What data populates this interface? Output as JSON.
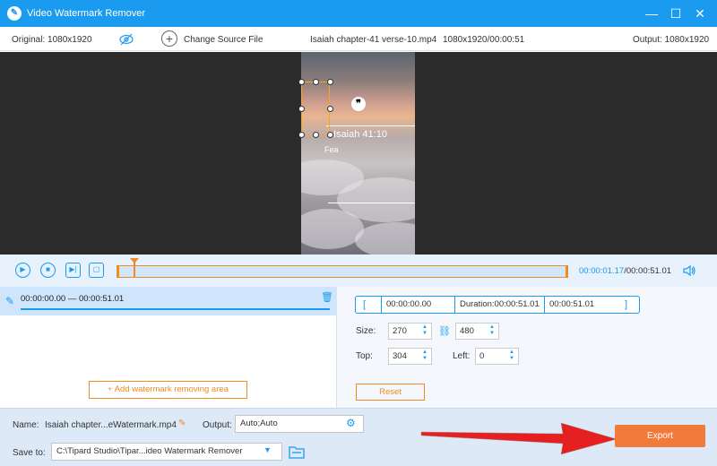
{
  "window": {
    "title": "Video Watermark Remover",
    "minimize": "—",
    "maximize": "☐",
    "close": "✕"
  },
  "infobar": {
    "original": "Original: 1080x1920",
    "change_source": "Change Source File",
    "file_info": "Isaiah chapter-41 verse-10.mp4",
    "resolution_duration": "1080x1920/00:00:51",
    "output": "Output: 1080x1920"
  },
  "video": {
    "caption": "Isaiah 41:10",
    "subcaption": "Fea"
  },
  "player": {
    "current_time": "00:00:01.17",
    "total_time": "/00:00:51.01"
  },
  "segment": {
    "range_label": "00:00:00.00 — 00:00:51.01"
  },
  "add_area_button": "+ Add watermark removing area",
  "time_range": {
    "start": "00:00:00.00",
    "duration": "Duration:00:00:51.01",
    "end": "00:00:51.01"
  },
  "size": {
    "label": "Size:",
    "width": "270",
    "height": "480"
  },
  "position": {
    "top_label": "Top:",
    "top": "304",
    "left_label": "Left:",
    "left": "0"
  },
  "reset_button": "Reset",
  "footer": {
    "name_label": "Name:",
    "name_value": "Isaiah chapter...eWatermark.mp4",
    "output_label": "Output:",
    "output_value": "Auto;Auto",
    "save_label": "Save to:",
    "save_path": "C:\\Tipard Studio\\Tipar...ideo Watermark Remover"
  },
  "export_button": "Export",
  "colors": {
    "accent": "#1a9bef",
    "orange": "#f08a24",
    "export": "#f27a3a",
    "arrow": "#e62020"
  }
}
